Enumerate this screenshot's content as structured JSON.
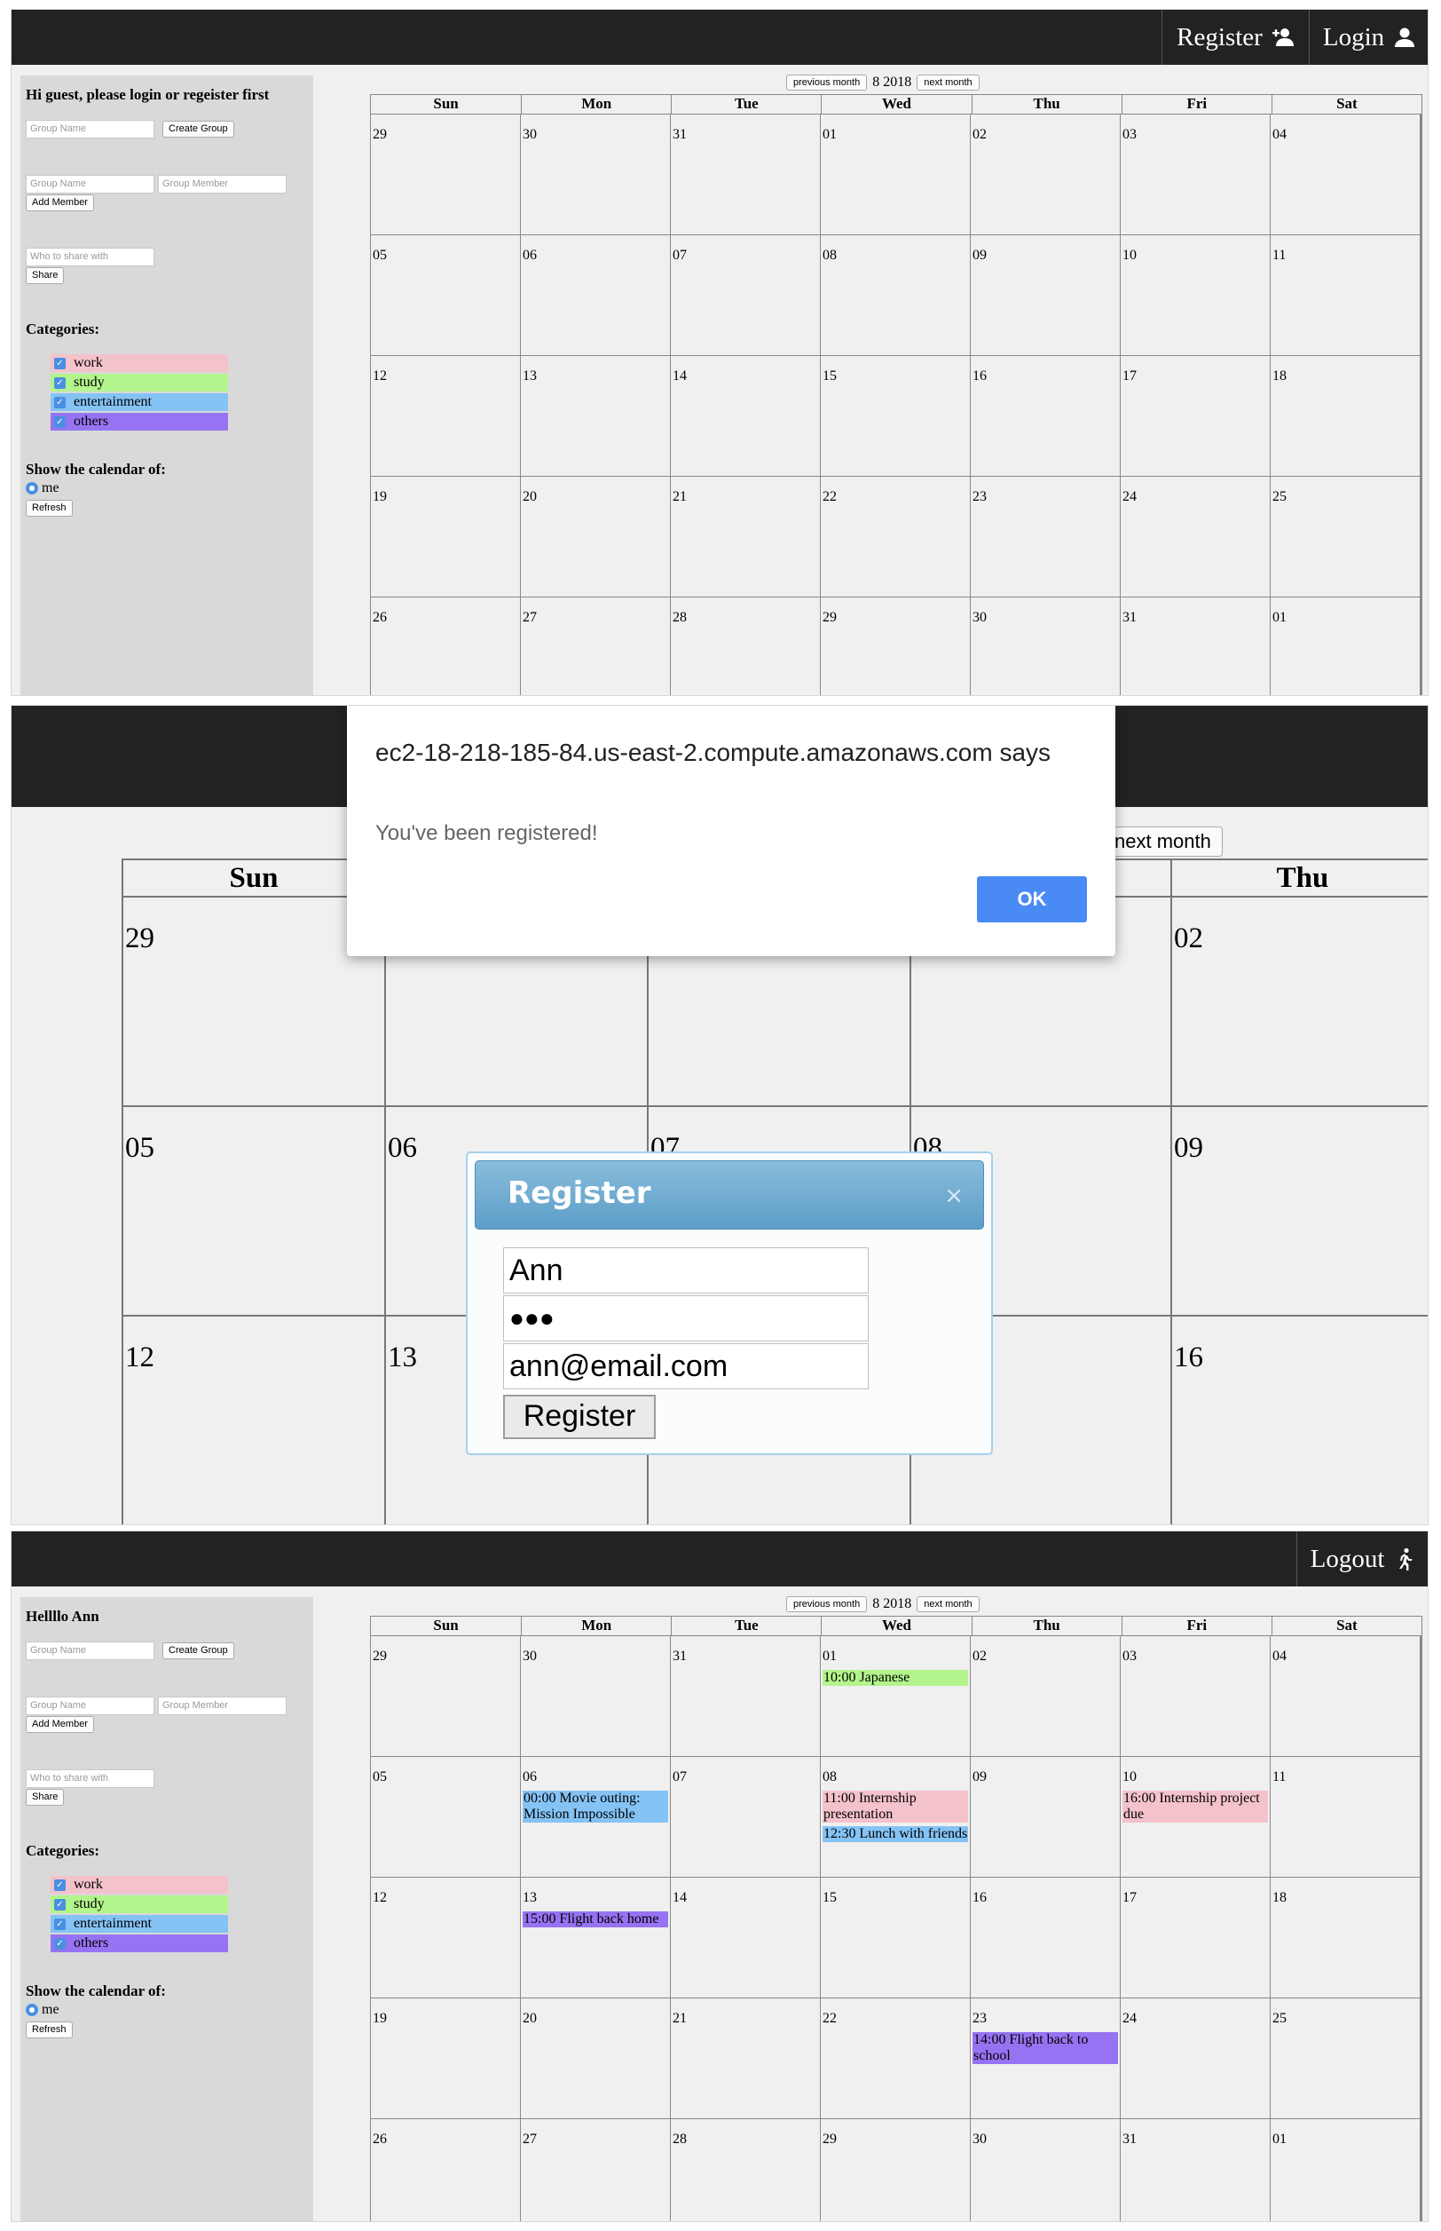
{
  "panel1": {
    "nav": {
      "register_label": "Register",
      "login_label": "Login"
    },
    "sidebar": {
      "greeting": "Hi guest, please login or regeister first",
      "group_name_placeholder": "Group Name",
      "create_group_label": "Create Group",
      "member_group_placeholder": "Group Name",
      "group_member_placeholder": "Group Member",
      "add_member_label": "Add Member",
      "share_placeholder": "Who to share with",
      "share_label": "Share",
      "categories_heading": "Categories:",
      "categories": [
        {
          "label": "work",
          "color": "#f4c2cb"
        },
        {
          "label": "study",
          "color": "#b3f48c"
        },
        {
          "label": "entertainment",
          "color": "#85c3f5"
        },
        {
          "label": "others",
          "color": "#9673f2"
        }
      ],
      "show_heading": "Show the calendar of:",
      "show_option": "me",
      "refresh_label": "Refresh"
    },
    "calendar": {
      "prev_label": "previous month",
      "month_year": "8 2018",
      "next_label": "next month",
      "weekdays": [
        "Sun",
        "Mon",
        "Tue",
        "Wed",
        "Thu",
        "Fri",
        "Sat"
      ],
      "weeks": [
        [
          "29",
          "30",
          "31",
          "01",
          "02",
          "03",
          "04"
        ],
        [
          "05",
          "06",
          "07",
          "08",
          "09",
          "10",
          "11"
        ],
        [
          "12",
          "13",
          "14",
          "15",
          "16",
          "17",
          "18"
        ],
        [
          "19",
          "20",
          "21",
          "22",
          "23",
          "24",
          "25"
        ],
        [
          "26",
          "27",
          "28",
          "29",
          "30",
          "31",
          "01"
        ]
      ]
    }
  },
  "panel2": {
    "alert": {
      "origin": "ec2-18-218-185-84.us-east-2.compute.amazonaws.com says",
      "message": "You've been registered!",
      "ok_label": "OK"
    },
    "next_month_label": "next month",
    "weekdays": [
      "Sun",
      "",
      "",
      "",
      "Thu"
    ],
    "weeks": [
      [
        "29",
        "",
        "",
        "",
        "02"
      ],
      [
        "05",
        "06",
        "07",
        "08",
        "09"
      ],
      [
        "12",
        "13",
        "",
        "",
        "16"
      ]
    ],
    "dialog": {
      "title": "Register",
      "close_glyph": "×",
      "username": "Ann",
      "password_mask": "●●●",
      "email": "ann@email.com",
      "submit_label": "Register"
    }
  },
  "panel3": {
    "nav": {
      "logout_label": "Logout"
    },
    "sidebar": {
      "greeting": "Hellllo Ann",
      "group_name_placeholder": "Group Name",
      "create_group_label": "Create Group",
      "member_group_placeholder": "Group Name",
      "group_member_placeholder": "Group Member",
      "add_member_label": "Add Member",
      "share_placeholder": "Who to share with",
      "share_label": "Share",
      "categories_heading": "Categories:",
      "categories": [
        {
          "label": "work",
          "color": "#f4c2cb"
        },
        {
          "label": "study",
          "color": "#b3f48c"
        },
        {
          "label": "entertainment",
          "color": "#85c3f5"
        },
        {
          "label": "others",
          "color": "#9673f2"
        }
      ],
      "show_heading": "Show the calendar of:",
      "show_option": "me",
      "refresh_label": "Refresh"
    },
    "calendar": {
      "prev_label": "previous month",
      "month_year": "8 2018",
      "next_label": "next month",
      "weekdays": [
        "Sun",
        "Mon",
        "Tue",
        "Wed",
        "Thu",
        "Fri",
        "Sat"
      ],
      "weeks": [
        [
          "29",
          "30",
          "31",
          "01",
          "02",
          "03",
          "04"
        ],
        [
          "05",
          "06",
          "07",
          "08",
          "09",
          "10",
          "11"
        ],
        [
          "12",
          "13",
          "14",
          "15",
          "16",
          "17",
          "18"
        ],
        [
          "19",
          "20",
          "21",
          "22",
          "23",
          "24",
          "25"
        ],
        [
          "26",
          "27",
          "28",
          "29",
          "30",
          "31",
          "01"
        ]
      ],
      "events": [
        {
          "week": 0,
          "day": 3,
          "text": "10:00 Japanese",
          "color": "#b3f48c"
        },
        {
          "week": 1,
          "day": 1,
          "text": "00:00 Movie outing: Mission Impossible",
          "color": "#85c3f5"
        },
        {
          "week": 1,
          "day": 3,
          "text": "11:00 Internship presentation",
          "color": "#f4c2cb"
        },
        {
          "week": 1,
          "day": 3,
          "text": "12:30 Lunch with friends",
          "color": "#85c3f5"
        },
        {
          "week": 1,
          "day": 5,
          "text": "16:00 Internship project due",
          "color": "#f4c2cb"
        },
        {
          "week": 2,
          "day": 1,
          "text": "15:00 Flight back home",
          "color": "#9673f2"
        },
        {
          "week": 3,
          "day": 4,
          "text": "14:00 Flight back to school",
          "color": "#9673f2"
        }
      ]
    }
  }
}
